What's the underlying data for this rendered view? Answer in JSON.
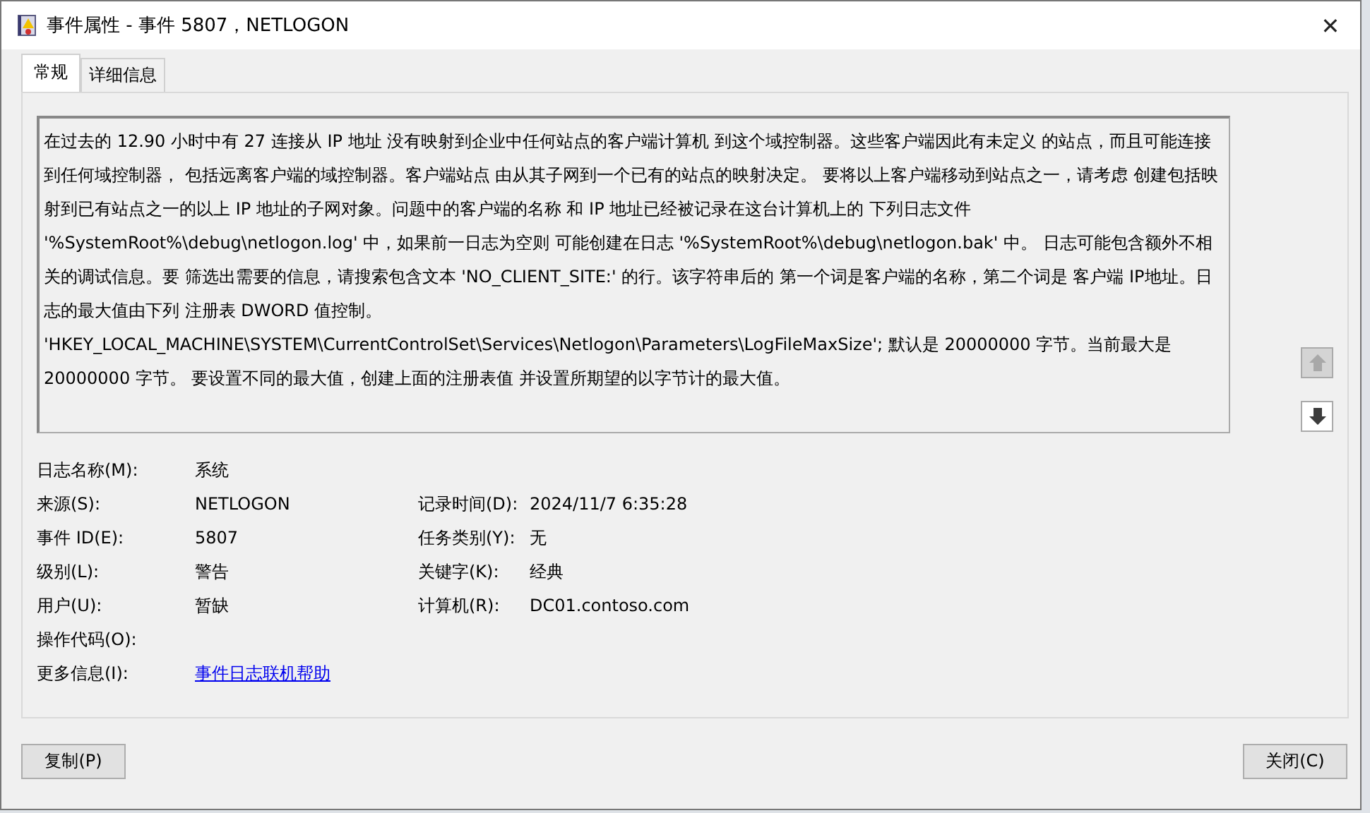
{
  "window": {
    "title": "事件属性 - 事件 5807，NETLOGON",
    "close": "✕"
  },
  "tabs": [
    {
      "label": "常规",
      "selected": true
    },
    {
      "label": "详细信息",
      "selected": false
    }
  ],
  "description": "在过去的 12.90 小时中有 27 连接从 IP 地址 没有映射到企业中任何站点的客户端计算机 到这个域控制器。这些客户端因此有未定义 的站点，而且可能连接到任何域控制器， 包括远离客户端的域控制器。客户端站点 由从其子网到一个已有的站点的映射决定。 要将以上客户端移动到站点之一，请考虑 创建包括映射到已有站点之一的以上 IP  地址的子网对象。问题中的客户端的名称 和 IP 地址已经被记录在这台计算机上的 下列日志文件 '%SystemRoot%\\debug\\netlogon.log' 中，如果前一日志为空则 可能创建在日志 '%SystemRoot%\\debug\\netlogon.bak' 中。 日志可能包含额外不相关的调试信息。要 筛选出需要的信息，请搜索包含文本 'NO_CLIENT_SITE:' 的行。该字符串后的 第一个词是客户端的名称，第二个词是 客户端 IP地址。日志的最大值由下列 注册表 DWORD 值控制。 'HKEY_LOCAL_MACHINE\\SYSTEM\\CurrentControlSet\\Services\\Netlogon\\Parameters\\LogFileMaxSize'; 默认是 20000000 字节。当前最大是 20000000 字节。 要设置不同的最大值，创建上面的注册表值 并设置所期望的以字节计的最大值。",
  "navigation": [
    {
      "kind": "up",
      "disabled": true
    },
    {
      "kind": "down",
      "disabled": false
    }
  ],
  "fields": [
    {
      "label": "日志名称(M):",
      "value": "系统"
    },
    {
      "label": "来源(S):",
      "value": "NETLOGON",
      "label_2": "记录时间(D):",
      "value_2": "2024/11/7 6:35:28"
    },
    {
      "label": "事件 ID(E):",
      "value": "5807",
      "label_2": "任务类别(Y):",
      "value_2": "无"
    },
    {
      "label": "级别(L):",
      "value": "警告",
      "label_2": "关键字(K):",
      "value_2": "经典"
    },
    {
      "label": "用户(U):",
      "value": "暂缺",
      "label_2": "计算机(R):",
      "value_2": "DC01.contoso.com"
    },
    {
      "label": "操作代码(O):"
    },
    {
      "label": "更多信息(I):",
      "value": "事件日志联机帮助",
      "kind": "link"
    }
  ],
  "buttons": [
    {
      "label": "复制(P)"
    },
    {
      "label": "关闭(C)"
    }
  ]
}
